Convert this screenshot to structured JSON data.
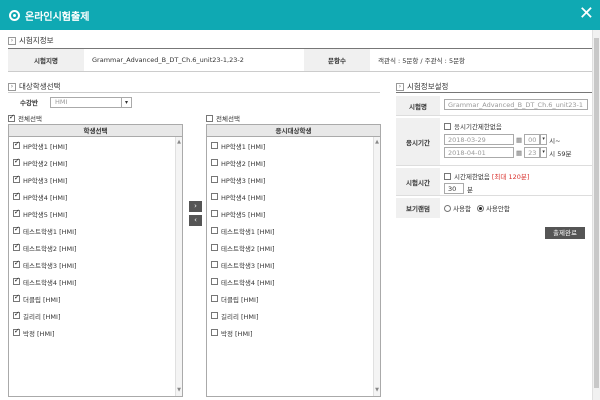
{
  "window": {
    "title": "온라인시험출제"
  },
  "exam_info": {
    "section_title": "시험지정보",
    "name_label": "시험지명",
    "name_value": "Grammar_Advanced_B_DT_Ch.6_unit23-1,23-2",
    "count_label": "문항수",
    "count_value": "객관식 : 5문항 / 주관식 : 5문항"
  },
  "student_select": {
    "section_title": "대상학생선택",
    "course_label": "수강반",
    "course_value": "HMI",
    "left_all_label": "전체선택",
    "right_all_label": "전체선택",
    "left_header": "학생선택",
    "right_header": "응시대상학생",
    "students": [
      "HP학생1 [HMI]",
      "HP학생2 [HMI]",
      "HP학생3 [HMI]",
      "HP학생4 [HMI]",
      "HP학생5 [HMI]",
      "테스트학생1 [HMI]",
      "테스트학생2 [HMI]",
      "테스트학생3 [HMI]",
      "테스트학생4 [HMI]",
      "더클립 [HMI]",
      "길리리 [HMI]",
      "박정 [HMI]"
    ],
    "move_right": "›",
    "move_left": "‹"
  },
  "exam_settings": {
    "section_title": "시험정보설정",
    "name_label": "시험명",
    "name_value": "Grammar_Advanced_B_DT_Ch.6_unit23-1",
    "period_label": "응시기간",
    "period_unlimited": "응시기간제한없음",
    "start_date": "2018-03-29",
    "start_hour": "00",
    "start_suffix": "시~",
    "end_date": "2018-04-01",
    "end_hour": "23",
    "end_suffix": "시 59분",
    "time_label": "시험시간",
    "time_unlimited": "시간제한없음",
    "time_max": "[최대 120분]",
    "time_value": "30",
    "time_unit": "분",
    "view_label": "보기랜덤",
    "view_use": "사용함",
    "view_nouse": "사용안함",
    "submit": "출제완료"
  },
  "colors": {
    "titlebar": "#0fa9b3",
    "max_time": "#d9302c"
  }
}
